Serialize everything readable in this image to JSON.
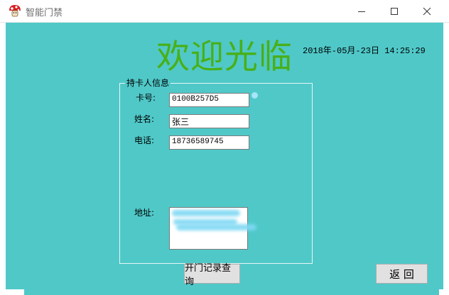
{
  "window": {
    "title": "智能门禁"
  },
  "header": {
    "welcome": "欢迎光临",
    "datetime": "2018年-05月-23日 14:25:29"
  },
  "card_info": {
    "group_title": "持卡人信息",
    "card_label": "卡号:",
    "card_value": "0100B257D5",
    "name_label": "姓名:",
    "name_value": "张三",
    "phone_label": "电话:",
    "phone_value": "18736589745",
    "address_label": "地址:",
    "address_value": ""
  },
  "buttons": {
    "records": "开门记录查询",
    "back": "返 回"
  },
  "colors": {
    "background": "#50c8c8",
    "welcome_text": "#48b018"
  }
}
